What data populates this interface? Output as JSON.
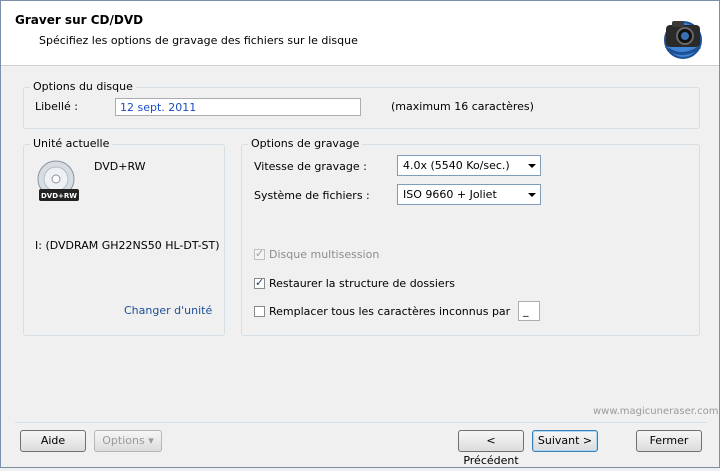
{
  "header": {
    "title": "Graver sur CD/DVD",
    "subtitle": "Spécifiez les options de gravage des fichiers sur le disque"
  },
  "disc_options": {
    "group_label": "Options du disque",
    "label_caption": "Libellé :",
    "label_value": "12 sept. 2011",
    "max_hint": "(maximum 16 caractères)"
  },
  "current_drive": {
    "group_label": "Unité actuelle",
    "media_type": "DVD+RW",
    "disc_badge": "DVD+RW",
    "drive_name": "I: (DVDRAM GH22NS50 HL-DT-ST)",
    "change_link": "Changer d'unité"
  },
  "burn_options": {
    "group_label": "Options de gravage",
    "speed_label": "Vitesse de gravage :",
    "speed_value": "4.0x (5540 Ko/sec.)",
    "fs_label": "Système de fichiers :",
    "fs_value": "ISO 9660 + Joliet",
    "multisession_label": "Disque multisession",
    "multisession_checked": true,
    "multisession_enabled": false,
    "restore_label": "Restaurer la structure de dossiers",
    "restore_checked": true,
    "replace_label": "Remplacer tous les caractères inconnus par",
    "replace_checked": false,
    "replace_char": "_"
  },
  "watermark": "www.magicuneraser.com",
  "buttons": {
    "help": "Aide",
    "options": "Options",
    "back": "< Précédent",
    "next": "Suivant >",
    "close": "Fermer"
  }
}
